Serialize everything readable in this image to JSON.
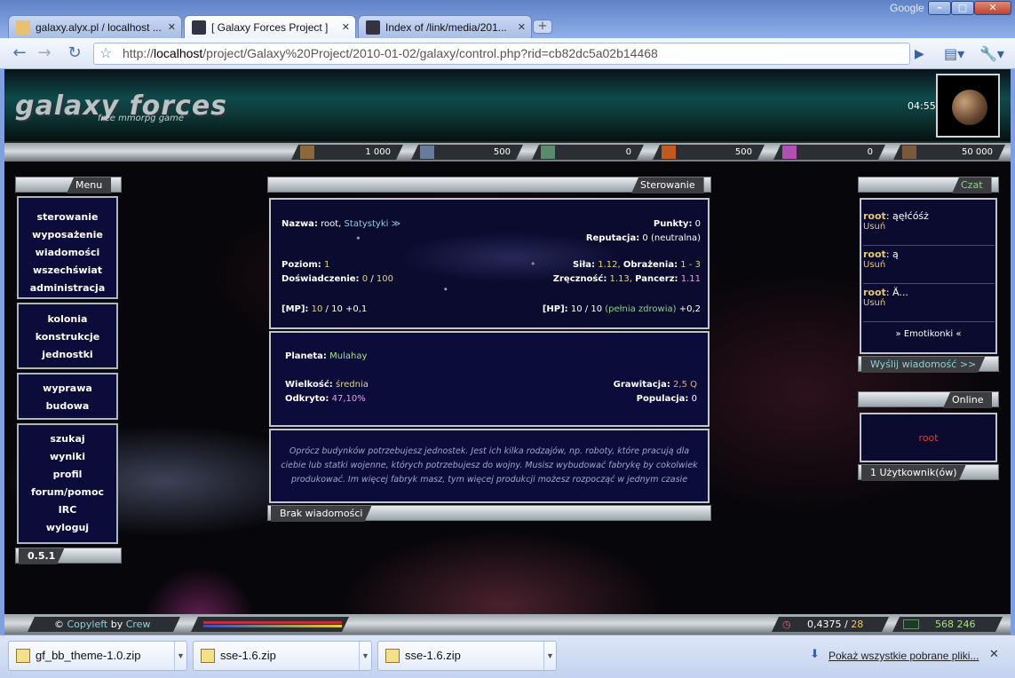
{
  "browser": {
    "google_label": "Google",
    "tabs": [
      {
        "title": "galaxy.alyx.pl / localhost ..."
      },
      {
        "title": "[ Galaxy Forces Project ]"
      },
      {
        "title": "Index of /link/media/201..."
      }
    ],
    "url_prefix": "http://",
    "url_host": "localhost",
    "url_rest": "/project/Galaxy%20Project/2010-01-02/galaxy/control.php?rid=cb82dc5a02b14468"
  },
  "header": {
    "logo": "galaxy forces",
    "logo_sub": "free mmorpg game",
    "clock": "04:55"
  },
  "resources": [
    "1 000",
    "500",
    "0",
    "500",
    "0",
    "50 000"
  ],
  "menu": {
    "title": "Menu",
    "groups": [
      [
        "sterowanie",
        "wyposażenie",
        "wiadomości",
        "wszechświat",
        "administracja"
      ],
      [
        "kolonia",
        "konstrukcje",
        "jednostki"
      ],
      [
        "wyprawa",
        "budowa"
      ],
      [
        "szukaj",
        "wyniki",
        "profil",
        "forum/pomoc",
        "IRC",
        "wyloguj"
      ]
    ],
    "version": "0.5.1"
  },
  "control": {
    "title": "Sterowanie",
    "name_label": "Nazwa:",
    "name_value": "root,",
    "stats_link": "Statystyki ≫",
    "points_label": "Punkty:",
    "points_value": "0",
    "reputation_label": "Reputacja:",
    "reputation_value": "0",
    "reputation_note": "(neutralna)",
    "level_label": "Poziom:",
    "level_value": "1",
    "exp_label": "Doświadczenie:",
    "exp_value": "0",
    "exp_max": "100",
    "strength_label": "Siła:",
    "strength_value": "1.12,",
    "damage_label": "Obrażenia:",
    "damage_value": "1 - 3",
    "dex_label": "Zręczność:",
    "dex_value": "1.13,",
    "armor_label": "Pancerz:",
    "armor_value": "1.11",
    "mp_label": "[MP]:",
    "mp_value": "10",
    "mp_rest": "/ 10 +0,1",
    "hp_label": "[HP]:",
    "hp_value": "10 / 10",
    "hp_note": "(pełnia zdrowia)",
    "hp_regen": "+0,2",
    "planet_label": "Planeta:",
    "planet_value": "Mulahay",
    "size_label": "Wielkość:",
    "size_value": "średnia",
    "discovered_label": "Odkryto:",
    "discovered_value": "47,10%",
    "gravity_label": "Grawitacja:",
    "gravity_value": "2,5 Q",
    "population_label": "Populacja:",
    "population_value": "0",
    "hint": "Oprócz budynków potrzebujesz jednostek. Jest ich kilka rodzajów, np. roboty, które pracują dla ciebie lub statki wojenne, których potrzebujesz do wojny. Musisz wybudować fabrykę by cokolwiek produkować. Im więcej fabryk masz, tym więcej produkcji możesz rozpocząć w jednym czasie",
    "no_messages": "Brak wiadomości"
  },
  "chat": {
    "title": "Czat",
    "messages": [
      {
        "user": "root",
        "text": ": ąęłćóśż",
        "remove": "Usuń"
      },
      {
        "user": "root",
        "text": ": ą",
        "remove": "Usuń"
      },
      {
        "user": "root",
        "text": ": Ä...",
        "remove": "Usuń"
      }
    ],
    "emoticons": "» Emotikonki «",
    "send": "Wyślij wiadomość >>"
  },
  "online": {
    "title": "Online",
    "user": "root",
    "count": "1 Użytkownik(ów)"
  },
  "footer": {
    "copy_symbol": "©",
    "copyleft": "Copyleft",
    "by": "by",
    "crew": "Crew",
    "time_value": "0,4375",
    "time_sep": "/",
    "time_total": "28",
    "counter": "568 246"
  },
  "downloads": {
    "items": [
      "gf_bb_theme-1.0.zip",
      "sse-1.6.zip",
      "sse-1.6.zip"
    ],
    "show_all": "Pokaż wszystkie pobrane pliki..."
  }
}
